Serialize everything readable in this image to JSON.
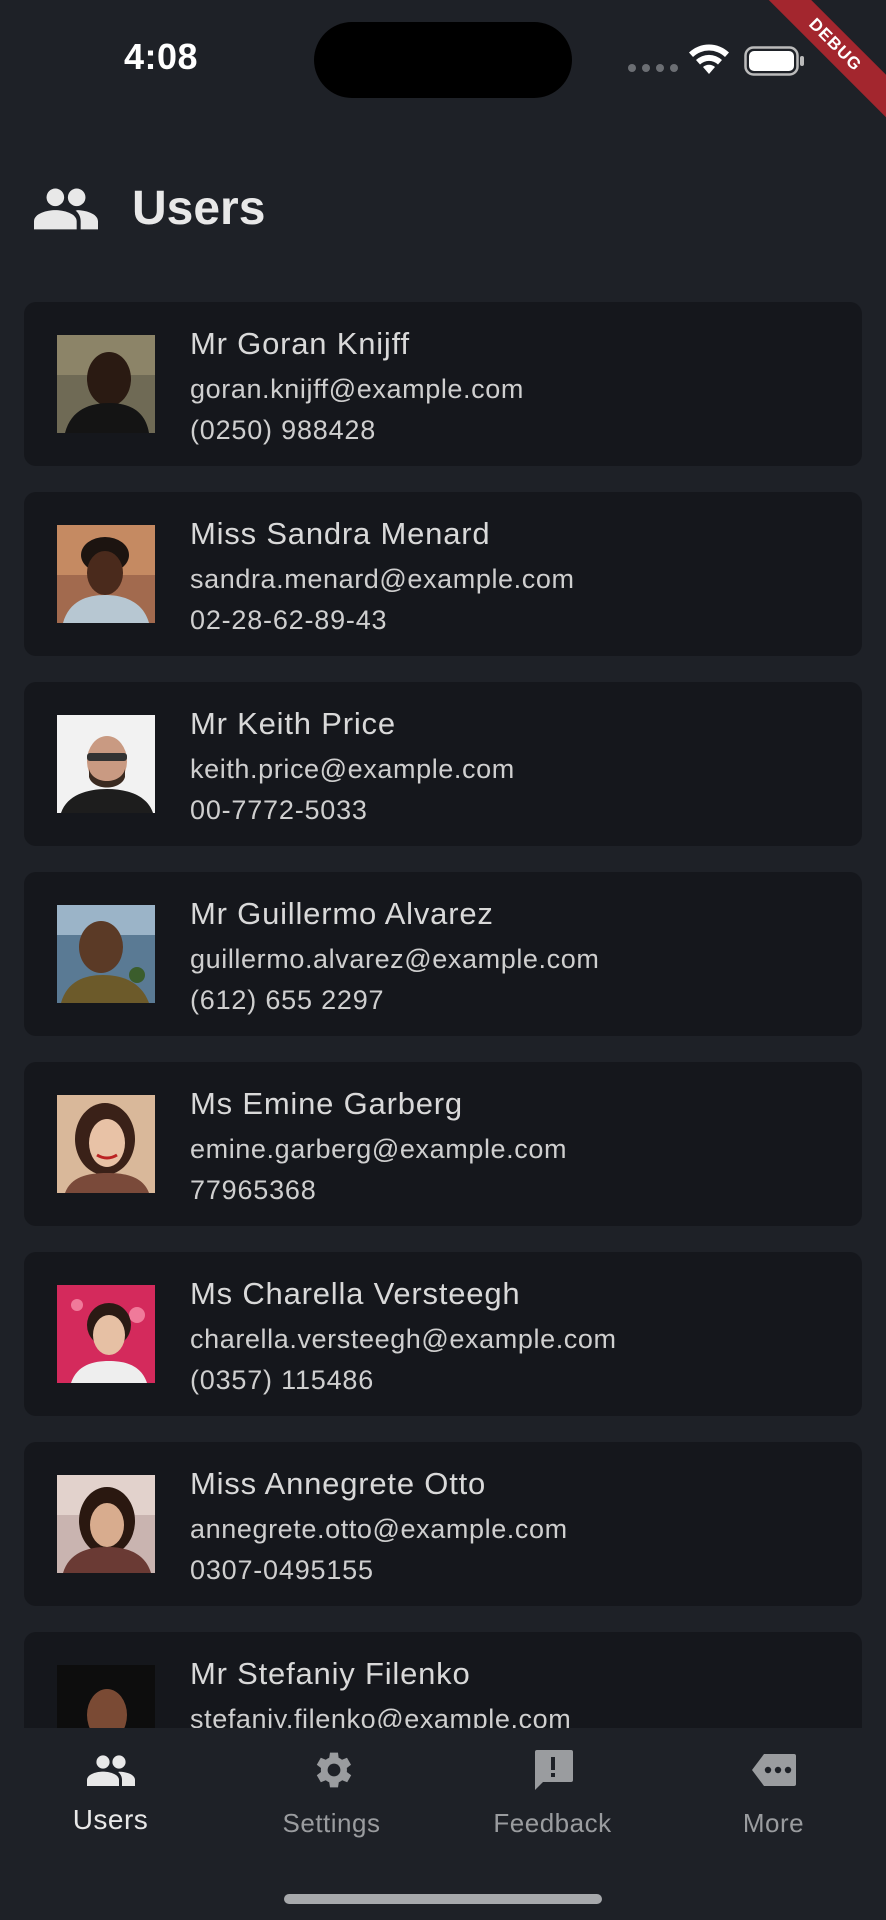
{
  "status_bar": {
    "time": "4:08",
    "debug_label": "DEBUG"
  },
  "header": {
    "title": "Users",
    "icon": "group-icon"
  },
  "users": [
    {
      "name": "Mr Goran Knijff",
      "email": "goran.knijff@example.com",
      "phone": "(0250) 988428"
    },
    {
      "name": "Miss Sandra Menard",
      "email": "sandra.menard@example.com",
      "phone": "02-28-62-89-43"
    },
    {
      "name": "Mr Keith Price",
      "email": "keith.price@example.com",
      "phone": "00-7772-5033"
    },
    {
      "name": "Mr Guillermo Alvarez",
      "email": "guillermo.alvarez@example.com",
      "phone": "(612) 655 2297"
    },
    {
      "name": "Ms Emine Garberg",
      "email": "emine.garberg@example.com",
      "phone": "77965368"
    },
    {
      "name": "Ms Charella Versteegh",
      "email": "charella.versteegh@example.com",
      "phone": "(0357) 115486"
    },
    {
      "name": "Miss Annegrete Otto",
      "email": "annegrete.otto@example.com",
      "phone": "0307-0495155"
    },
    {
      "name": "Mr Stefaniy Filenko",
      "email": "stefaniy.filenko@example.com",
      "phone": ""
    }
  ],
  "nav": {
    "items": [
      {
        "label": "Users",
        "icon": "group-icon",
        "active": true
      },
      {
        "label": "Settings",
        "icon": "gear-icon",
        "active": false
      },
      {
        "label": "Feedback",
        "icon": "feedback-icon",
        "active": false
      },
      {
        "label": "More",
        "icon": "more-icon",
        "active": false
      }
    ]
  },
  "colors": {
    "background": "#1e2127",
    "card": "#15171c",
    "text": "#d9d9d9",
    "nav_inactive": "#9a9c9f",
    "debug": "#a3262e"
  }
}
